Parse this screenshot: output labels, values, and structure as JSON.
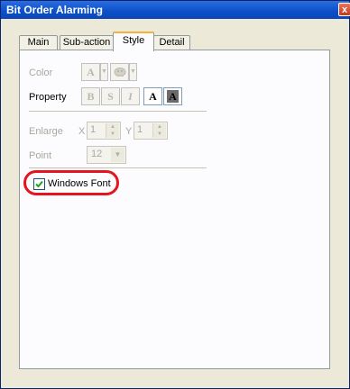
{
  "window": {
    "title": "Bit Order Alarming",
    "close_glyph": "x"
  },
  "tabs": [
    {
      "label": "Main"
    },
    {
      "label": "Sub-action"
    },
    {
      "label": "Style"
    },
    {
      "label": "Detail"
    }
  ],
  "style": {
    "color_label": "Color",
    "property_label": "Property",
    "enlarge_label": "Enlarge",
    "x_label": "X",
    "x_value": "1",
    "y_label": "Y",
    "y_value": "1",
    "point_label": "Point",
    "point_value": "12",
    "windows_font_label": "Windows Font",
    "windows_font_checked": true,
    "color_text_glyph": "A",
    "property_buttons": [
      "B",
      "S",
      "I",
      "A",
      "A"
    ]
  },
  "colors": {
    "highlight_oval": "#e5141e",
    "active_tab_accent": "#f6b13c",
    "title_bar": "#0b4fc9"
  }
}
